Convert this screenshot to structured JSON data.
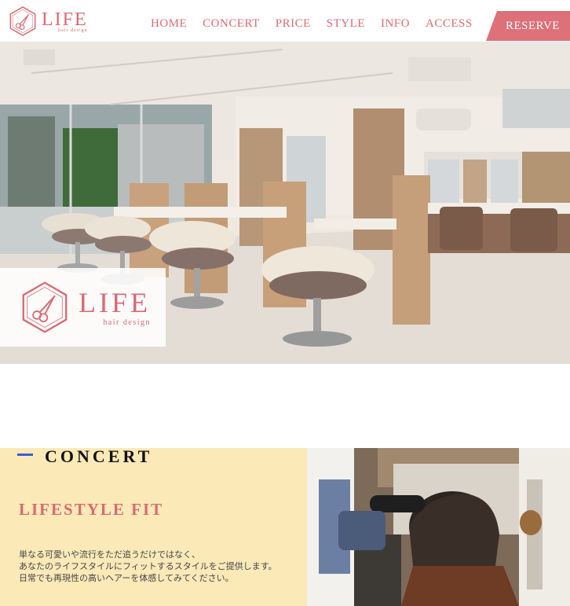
{
  "brand": {
    "name": "LIFE",
    "tagline": "hair design",
    "accent": "#d96a72"
  },
  "nav": {
    "items": [
      "HOME",
      "CONCERT",
      "PRICE",
      "STYLE",
      "INFO",
      "ACCESS"
    ],
    "reserve_label": "RESERVE",
    "reserve_color": "#dd7078"
  },
  "hero": {
    "logo_name": "LIFE",
    "logo_tagline": "hair design"
  },
  "concert": {
    "heading": "CONCERT",
    "subheading": "LIFESTYLE FIT",
    "lines": [
      "単なる可愛いや流行をただ追うだけではなく、",
      "あなたのライフスタイルにフィットするスタイルをご提供します。",
      "日常でも再現性の高いヘアーを体感してみてください。"
    ],
    "panel_color": "#fbe9b8",
    "line_color": "#3d5dd6"
  }
}
